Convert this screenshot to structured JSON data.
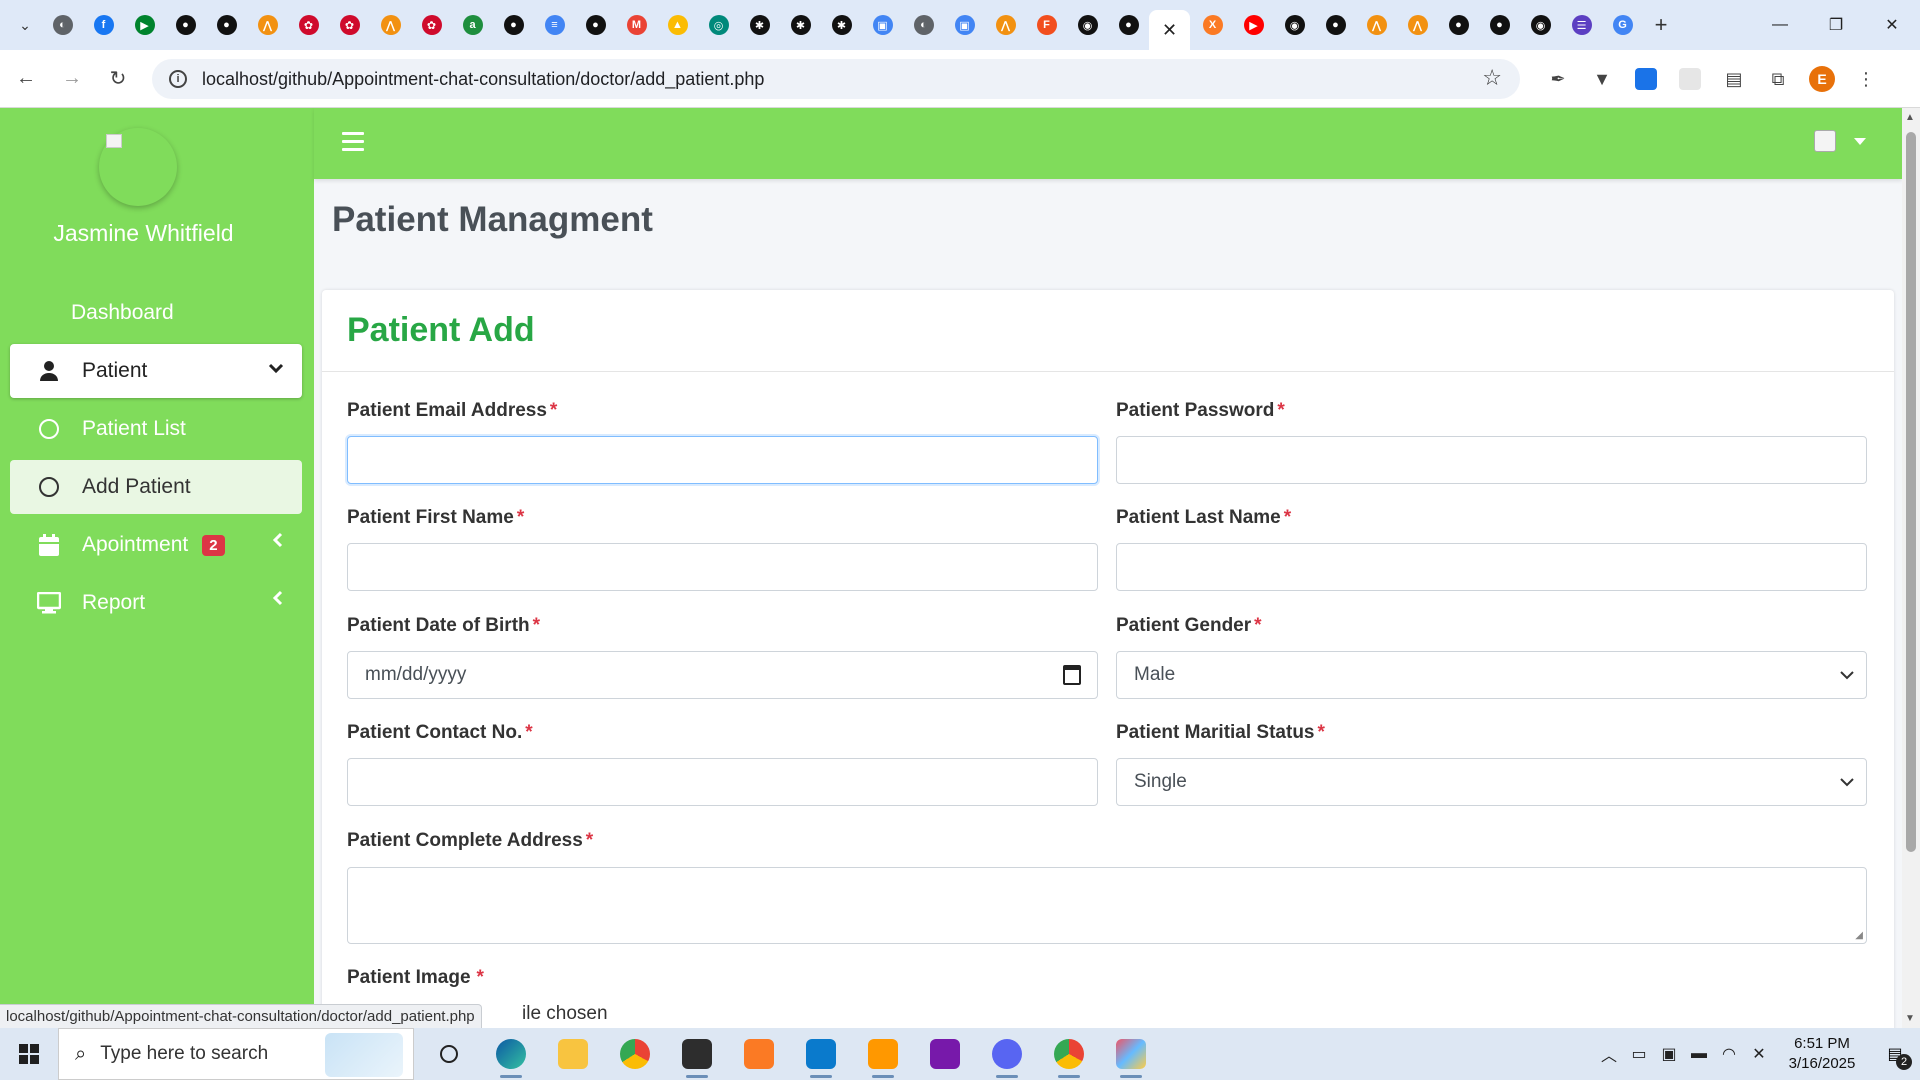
{
  "browser": {
    "url": "localhost/github/Appointment-chat-consultation/doctor/add_patient.php",
    "status_url": "localhost/github/Appointment-chat-consultation/doctor/add_patient.php",
    "profile_initial": "E",
    "tab_favicons": [
      {
        "name": "globe",
        "color": "#5f6368",
        "glyph": "◐"
      },
      {
        "name": "facebook",
        "color": "#1877f2",
        "glyph": "f"
      },
      {
        "name": "meet",
        "color": "#00832d",
        "glyph": "▶"
      },
      {
        "name": "chatgpt",
        "color": "#111111",
        "glyph": "●"
      },
      {
        "name": "chatgpt",
        "color": "#111111",
        "glyph": "●"
      },
      {
        "name": "pma",
        "color": "#f29111",
        "glyph": "⋀"
      },
      {
        "name": "huawei",
        "color": "#cf0a2c",
        "glyph": "✿"
      },
      {
        "name": "huawei",
        "color": "#cf0a2c",
        "glyph": "✿"
      },
      {
        "name": "pma",
        "color": "#f29111",
        "glyph": "⋀"
      },
      {
        "name": "huawei",
        "color": "#cf0a2c",
        "glyph": "✿"
      },
      {
        "name": "aa",
        "color": "#1e8e3e",
        "glyph": "a"
      },
      {
        "name": "chatgpt",
        "color": "#111111",
        "glyph": "●"
      },
      {
        "name": "docs",
        "color": "#4285f4",
        "glyph": "≡"
      },
      {
        "name": "chatgpt",
        "color": "#111111",
        "glyph": "●"
      },
      {
        "name": "gmail",
        "color": "#ea4335",
        "glyph": "M"
      },
      {
        "name": "drive",
        "color": "#fbbc04",
        "glyph": "▲"
      },
      {
        "name": "search",
        "color": "#00897b",
        "glyph": "◎"
      },
      {
        "name": "openai",
        "color": "#111111",
        "glyph": "✱"
      },
      {
        "name": "openai",
        "color": "#111111",
        "glyph": "✱"
      },
      {
        "name": "openai",
        "color": "#111111",
        "glyph": "✱"
      },
      {
        "name": "calendar",
        "color": "#4285f4",
        "glyph": "▣"
      },
      {
        "name": "globe",
        "color": "#5f6368",
        "glyph": "◐"
      },
      {
        "name": "calendar",
        "color": "#4285f4",
        "glyph": "▣"
      },
      {
        "name": "pma",
        "color": "#f29111",
        "glyph": "⋀"
      },
      {
        "name": "figma",
        "color": "#f24e1e",
        "glyph": "F"
      },
      {
        "name": "github",
        "color": "#111111",
        "glyph": "◉"
      },
      {
        "name": "chatgpt",
        "color": "#111111",
        "glyph": "●"
      }
    ],
    "tab_favicons_after": [
      {
        "name": "xampp",
        "color": "#fb7a24",
        "glyph": "X"
      },
      {
        "name": "youtube",
        "color": "#ff0000",
        "glyph": "▶"
      },
      {
        "name": "github",
        "color": "#111111",
        "glyph": "◉"
      },
      {
        "name": "chatgpt",
        "color": "#111111",
        "glyph": "●"
      },
      {
        "name": "pma",
        "color": "#f29111",
        "glyph": "⋀"
      },
      {
        "name": "pma",
        "color": "#f29111",
        "glyph": "⋀"
      },
      {
        "name": "chatgpt",
        "color": "#111111",
        "glyph": "●"
      },
      {
        "name": "chatgpt",
        "color": "#111111",
        "glyph": "●"
      },
      {
        "name": "github",
        "color": "#111111",
        "glyph": "◉"
      },
      {
        "name": "list",
        "color": "#5c3fc2",
        "glyph": "☰"
      },
      {
        "name": "google",
        "color": "#4285f4",
        "glyph": "G"
      }
    ]
  },
  "sidebar": {
    "user_name": "Jasmine Whitfield",
    "items": [
      {
        "label": "Dashboard"
      },
      {
        "label": "Patient"
      },
      {
        "label": "Patient List"
      },
      {
        "label": "Add Patient"
      },
      {
        "label": "Apointment",
        "badge": "2"
      },
      {
        "label": "Report"
      }
    ]
  },
  "header": {
    "page_title": "Patient Managment"
  },
  "form": {
    "title": "Patient Add",
    "required_mark": "*",
    "email_label": "Patient Email Address",
    "password_label": "Patient Password",
    "first_name_label": "Patient First Name",
    "last_name_label": "Patient Last Name",
    "dob_label": "Patient Date of Birth",
    "dob_placeholder": "mm/dd/yyyy",
    "gender_label": "Patient Gender",
    "gender_value": "Male",
    "contact_label": "Patient Contact No.",
    "marital_label": "Patient Maritial Status",
    "marital_value": "Single",
    "address_label": "Patient Complete Address",
    "image_label": "Patient Image",
    "file_status": "ile chosen"
  },
  "taskbar": {
    "search_placeholder": "Type here to search",
    "time": "6:51 PM",
    "date": "3/16/2025",
    "notifications": "2"
  },
  "colors": {
    "sidebar_bg": "#80dc5b",
    "card_title": "#28a745",
    "badge": "#dc3545"
  }
}
